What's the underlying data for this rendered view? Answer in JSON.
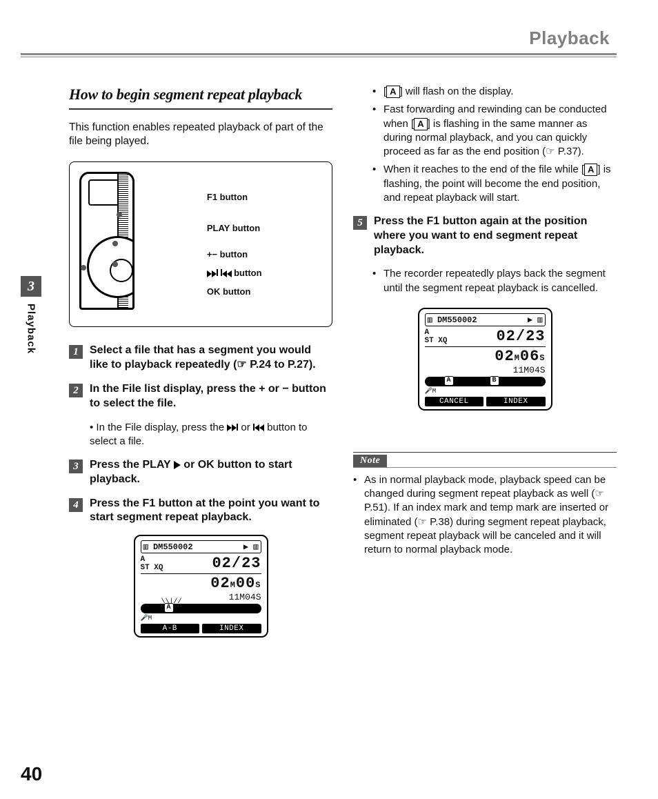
{
  "header": {
    "title": "Playback"
  },
  "side": {
    "chapter": "3",
    "label": "Playback"
  },
  "page_number": "40",
  "section_title": "How to begin segment repeat playback",
  "intro": "This function enables repeated playback of part of the file being played.",
  "device_labels": {
    "f1": "F1 button",
    "play": "PLAY button",
    "plusminus": "+− button",
    "ffrw": " button",
    "ok": "OK button"
  },
  "steps": {
    "s1": "Select a file that has a segment you would like to playback repeatedly (☞ P.24 to P.27).",
    "s2": "In the File list display, press the + or − button to select the file.",
    "s2_sub": "In the File display, press the        or        button to select a file.",
    "s3_a": "Press the PLAY ",
    "s3_b": " or OK button to start playback.",
    "s4": "Press the F1 button at the point you want to start segment repeat playback.",
    "s5": "Press the F1 button again at the position where you want to end segment repeat playback.",
    "s5_sub": "The recorder repeatedly plays back the segment until the segment repeat playback is cancelled."
  },
  "right_bullets": {
    "b1_a": "[",
    "b1_b": "] will flash on the display.",
    "b2_a": "Fast forwarding and rewinding can be conducted when [",
    "b2_b": "] is flashing in the same manner as during normal playback, and you can quickly proceed as far as the end position (☞ P.37).",
    "b3_a": "When it reaches to the end of the file while [",
    "b3_b": "] is flashing, the point will become the end position, and repeat playback will start."
  },
  "lcd1": {
    "file": "DM550002",
    "pos": "02/23",
    "flags": "ST XQ",
    "time": "02M00S",
    "dur": "11M04S",
    "btn_l": "A-B",
    "btn_r": "INDEX"
  },
  "lcd2": {
    "file": "DM550002",
    "pos": "02/23",
    "flags": "ST XQ",
    "time": "02M06S",
    "dur": "11M04S",
    "btn_l": "CANCEL",
    "btn_r": "INDEX"
  },
  "note": {
    "label": "Note",
    "body": "As in normal playback mode, playback speed can be changed during segment repeat playback as well (☞ P.51). If an index mark and temp mark are inserted or eliminated (☞ P.38) during segment repeat playback, segment repeat playback will be canceled and it will return to normal playback mode."
  }
}
